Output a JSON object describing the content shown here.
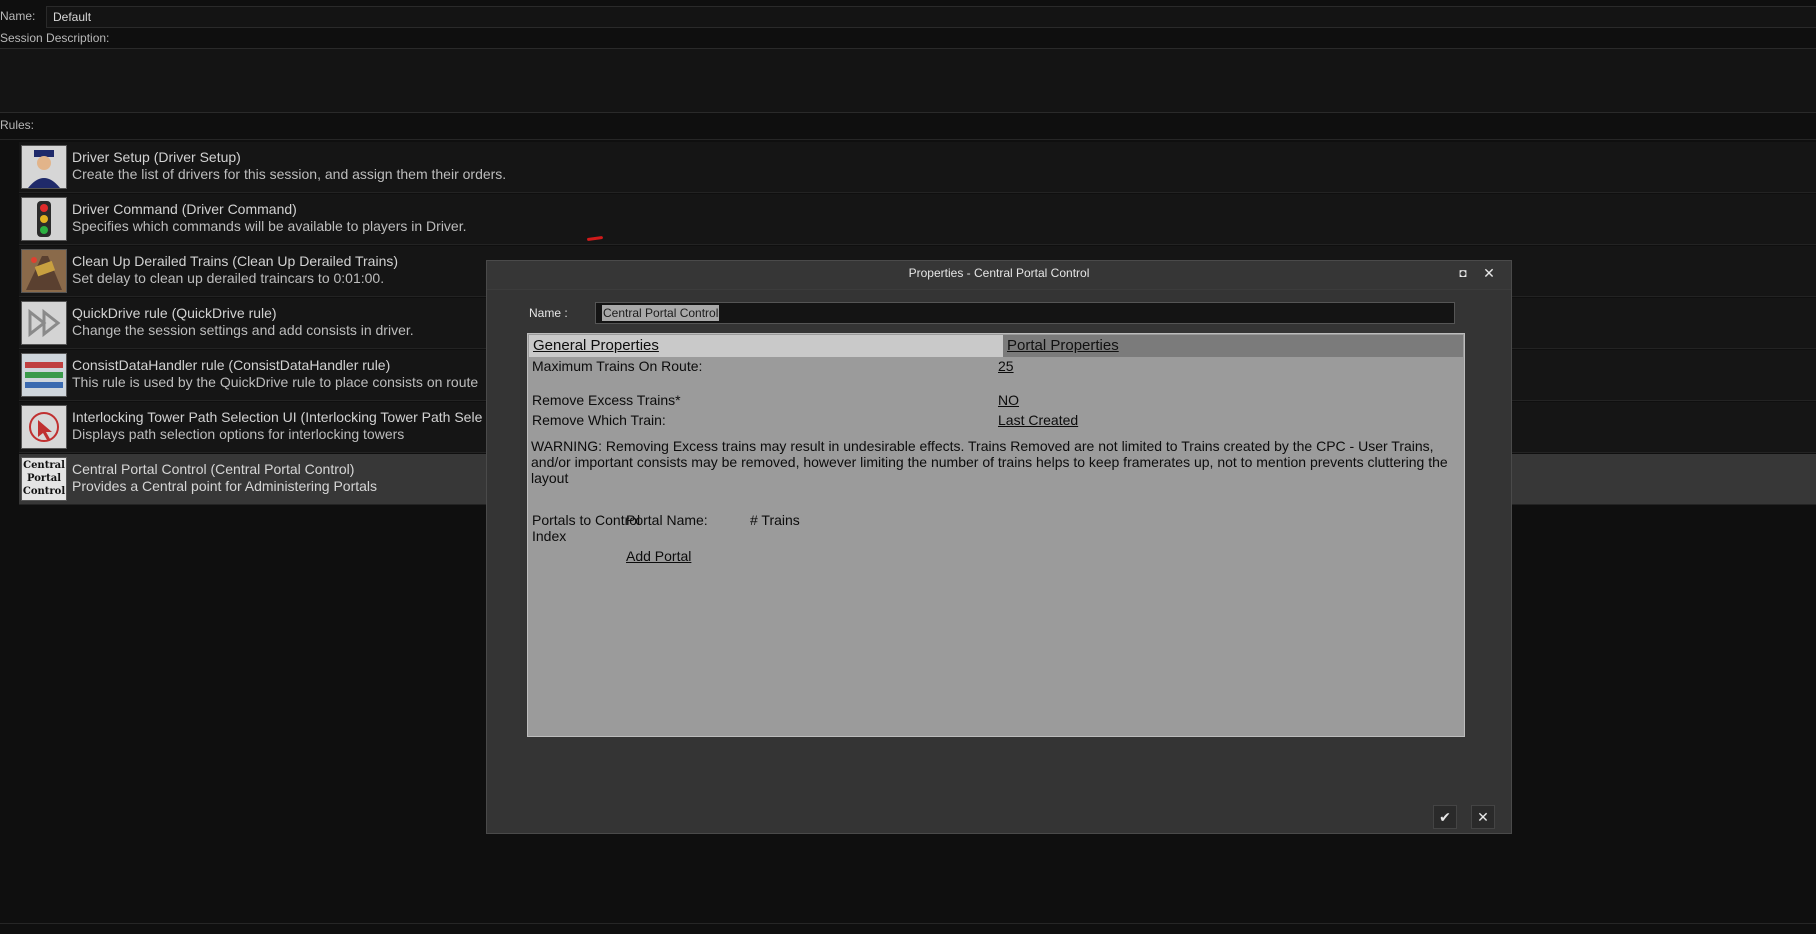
{
  "session": {
    "name_label": "Name:",
    "name_value": "Default",
    "description_label": "Session Description:",
    "rules_label": "Rules:"
  },
  "rules": [
    {
      "title": "Driver Setup  (Driver Setup)",
      "desc": "Create the list of drivers for this session, and assign them their orders.",
      "icon": "driver-icon"
    },
    {
      "title": "Driver Command  (Driver Command)",
      "desc": "Specifies which commands will be available to players in Driver.",
      "icon": "traffic-signal-icon"
    },
    {
      "title": "Clean Up Derailed Trains  (Clean Up Derailed Trains)",
      "desc": "Set delay to clean up derailed traincars to 0:01:00.",
      "icon": "derailed-train-icon"
    },
    {
      "title": "QuickDrive rule  (QuickDrive rule)",
      "desc": "Change the session settings and add consists in driver.",
      "icon": "fast-forward-icon"
    },
    {
      "title": "ConsistDataHandler rule  (ConsistDataHandler rule)",
      "desc": "This rule is used by the QuickDrive rule to place consists on route",
      "icon": "consist-icon"
    },
    {
      "title": "Interlocking Tower Path Selection UI  (Interlocking Tower Path Sele",
      "desc": "Displays path selection options for interlocking towers",
      "icon": "path-selection-icon"
    },
    {
      "title": "Central Portal Control  (Central Portal Control)",
      "desc": "Provides a Central point for Administering Portals",
      "icon": "central-portal-control-icon",
      "icon_text": [
        "Central",
        "Portal",
        "Control"
      ]
    }
  ],
  "dialog": {
    "title": "Properties - Central Portal Control",
    "name_label": "Name :",
    "name_value": "Central Portal Control",
    "tabs": {
      "general": "General Properties",
      "portal": "Portal Properties"
    },
    "fields": {
      "max_trains_label": "Maximum Trains On Route:",
      "max_trains_value": "25",
      "remove_excess_label": "Remove Excess Trains*",
      "remove_excess_value": "NO",
      "remove_which_label": "Remove Which Train:",
      "remove_which_value": "Last Created"
    },
    "warning": "WARNING: Removing Excess trains may result in undesirable effects. Trains Removed are not limited to Trains created by the CPC - User Trains, and/or important consists may be removed, however limiting the number of trains helps to keep framerates up, not to mention prevents cluttering the layout",
    "portals": {
      "col_control": "Portals to Control",
      "col_name": "Portal Name:",
      "col_trains": "# Trains",
      "col_index": "Index",
      "add_link": "Add Portal"
    },
    "ok_symbol": "✔",
    "cancel_symbol": "✕",
    "maximize_symbol": "◘",
    "close_symbol": "✕"
  }
}
